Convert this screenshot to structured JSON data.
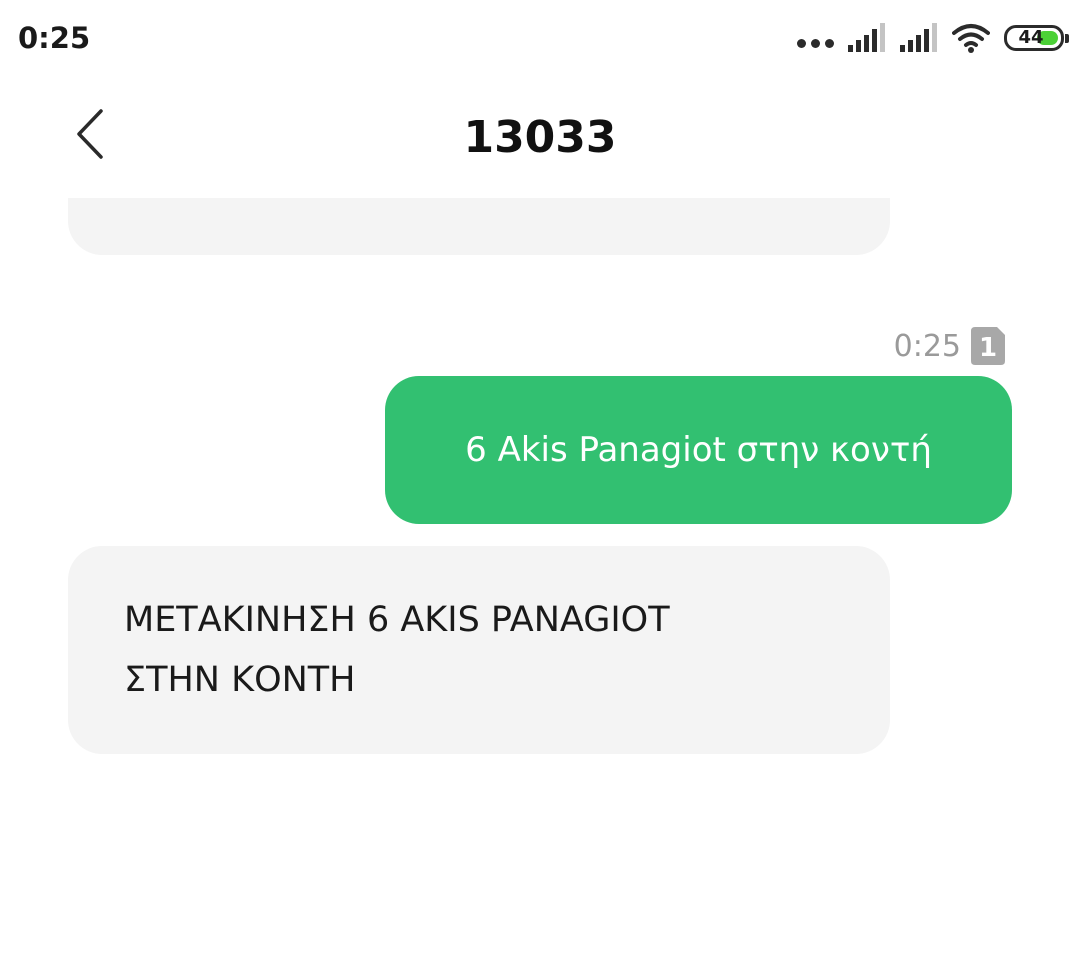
{
  "status_bar": {
    "time": "0:25",
    "battery_level": "44",
    "battery_fraction": 0.44,
    "icons": [
      "more-dots-icon",
      "signal-sim1-icon",
      "signal-sim2-icon",
      "wifi-icon",
      "battery-icon"
    ]
  },
  "header": {
    "title": "13033",
    "back_icon": "chevron-left-icon"
  },
  "conversation": {
    "sent_message": {
      "time": "0:25",
      "sim_badge": "1",
      "text": "6 Akis Panagiot στην κοντή"
    },
    "received_message": {
      "lines": [
        "ΜΕΤΑΚΙΝΗΣΗ 6 AKIS PANAGIOT",
        "ΣΤΗΝ ΚΟΝΤΗ"
      ]
    }
  },
  "colors": {
    "sent_bubble": "#32c071",
    "received_bubble": "#f4f4f4",
    "meta_text": "#9a9a9a",
    "battery_fill": "#4cd137"
  }
}
